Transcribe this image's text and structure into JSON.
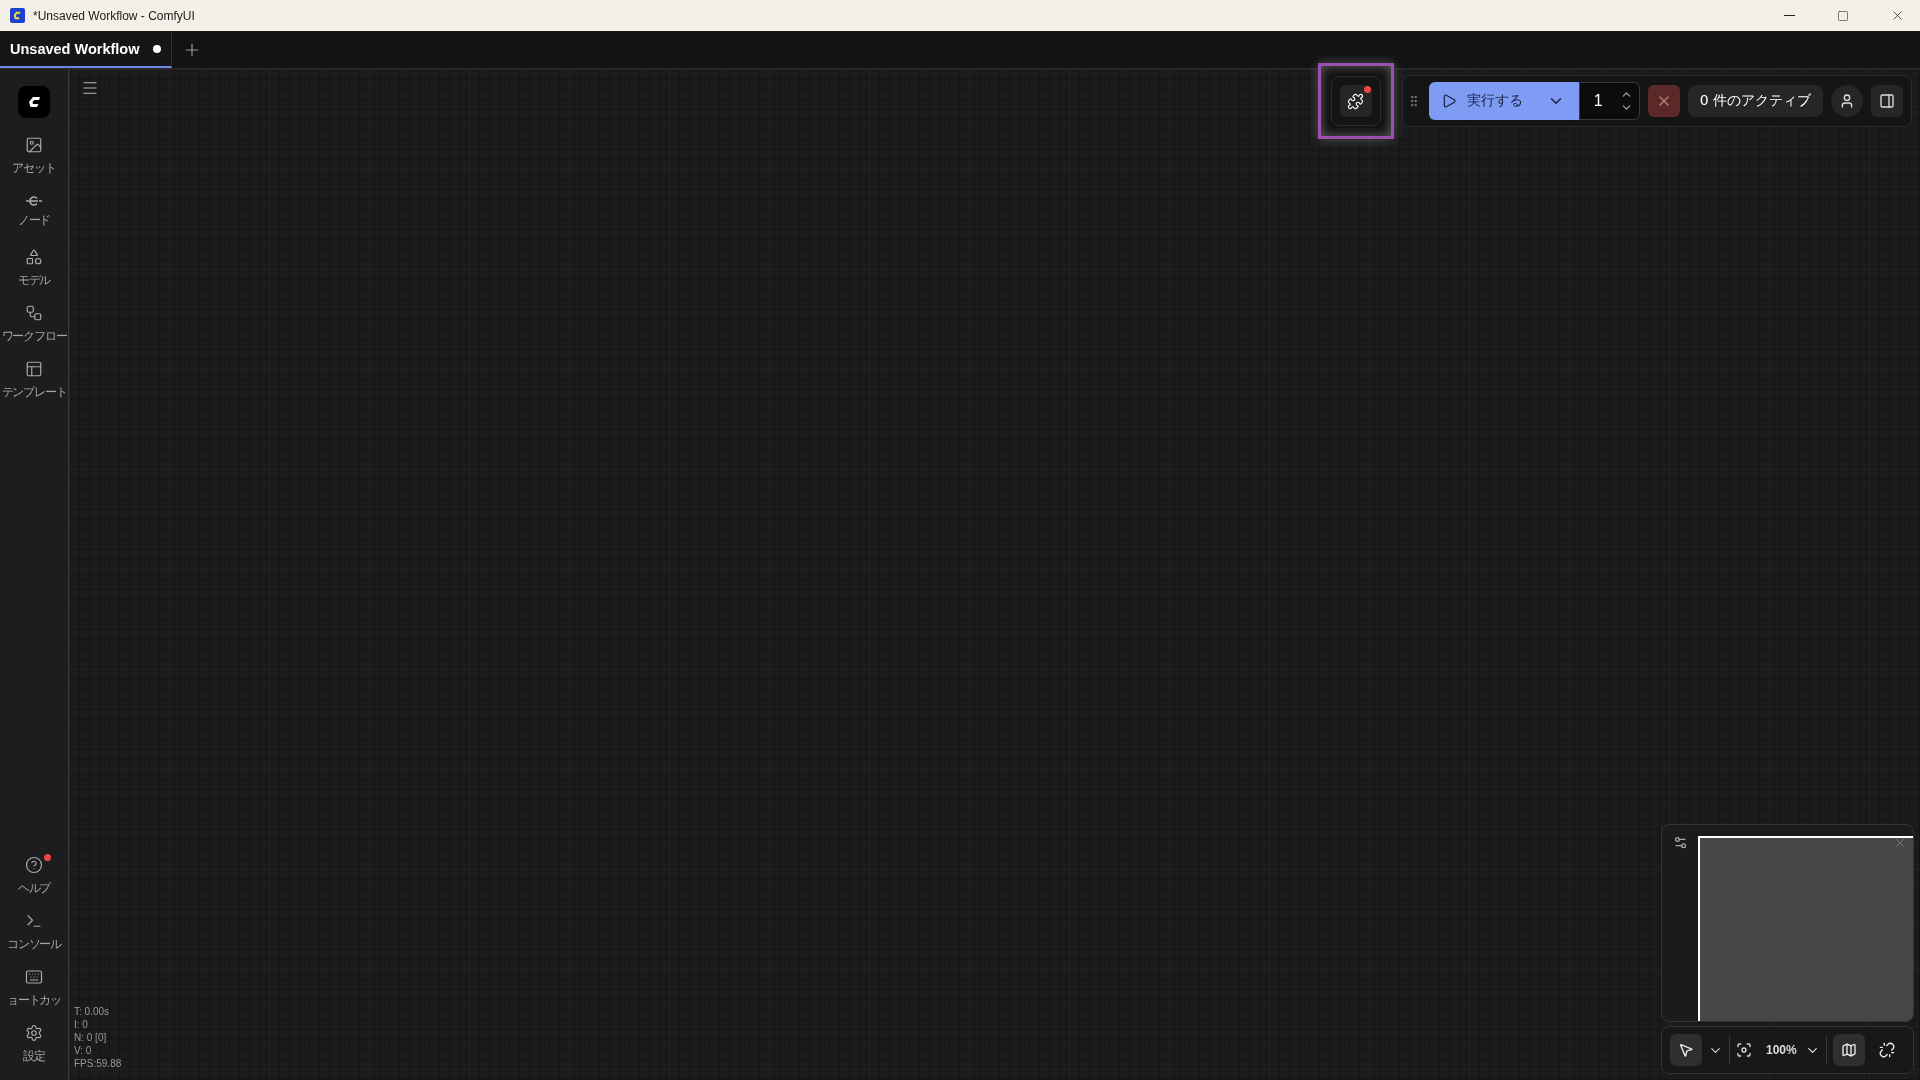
{
  "window": {
    "title": "*Unsaved Workflow - ComfyUI"
  },
  "tabs": [
    {
      "label": "Unsaved Workflow",
      "selected": true,
      "unsaved": true
    }
  ],
  "sidebar": {
    "top": [
      {
        "kind": "assets",
        "label": "アセット"
      },
      {
        "kind": "nodes",
        "label": "ノード"
      },
      {
        "kind": "models",
        "label": "モデル"
      },
      {
        "kind": "workflows",
        "label": "ワークフロー"
      },
      {
        "kind": "templates",
        "label": "テンプレート"
      }
    ],
    "bottom": [
      {
        "kind": "help",
        "label": "ヘルプ",
        "badge": true
      },
      {
        "kind": "console",
        "label": "コンソール",
        "badge": false
      },
      {
        "kind": "shortcuts",
        "label": "ョートカッ",
        "badge": false
      },
      {
        "kind": "settings",
        "label": "設定",
        "badge": false
      }
    ]
  },
  "toolbar": {
    "extensions": {
      "highlighted": true,
      "badge": true
    },
    "run": {
      "label": "実行する"
    },
    "batch_count": "1",
    "queue": {
      "label": "0 件のアクティブ"
    }
  },
  "stats": [
    "T: 0.00s",
    "I: 0",
    "N: 0 [0]",
    "V: 0",
    "FPS:59.88"
  ],
  "canvas_controls": {
    "select_active": true,
    "zoom": "100%",
    "minimap_active": true
  }
}
